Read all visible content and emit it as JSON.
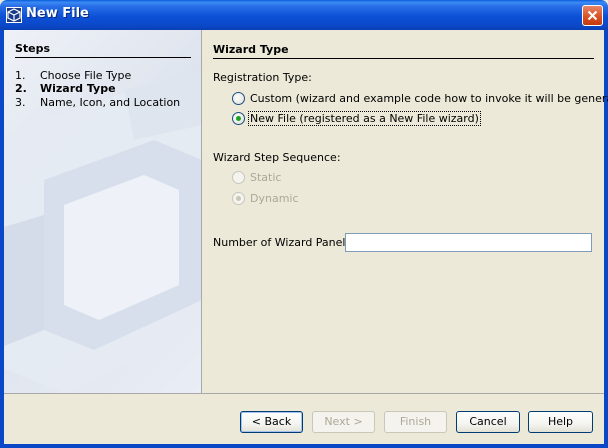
{
  "window": {
    "title": "New File"
  },
  "steps": {
    "title": "Steps",
    "items": [
      {
        "num": "1.",
        "label": "Choose File Type",
        "current": false
      },
      {
        "num": "2.",
        "label": "Wizard Type",
        "current": true
      },
      {
        "num": "3.",
        "label": "Name, Icon, and Location",
        "current": false
      }
    ]
  },
  "content": {
    "section_title": "Wizard Type",
    "registration_label": "Registration Type:",
    "registration_options": [
      {
        "label": "Custom (wizard and example code how to invoke it will be generated)",
        "checked": false
      },
      {
        "label": "New File (registered as a New File wizard)",
        "checked": true
      }
    ],
    "sequence_label": "Wizard Step Sequence:",
    "sequence_options": [
      {
        "label": "Static",
        "checked": false,
        "disabled": true
      },
      {
        "label": "Dynamic",
        "checked": true,
        "disabled": true
      }
    ],
    "panels_label": "Number of Wizard Panels:",
    "panels_value": ""
  },
  "buttons": {
    "back": "< Back",
    "next": "Next >",
    "finish": "Finish",
    "cancel": "Cancel",
    "help": "Help"
  },
  "icons": {
    "title": "netbeans-cube-icon",
    "close": "close-icon"
  },
  "colors": {
    "titlebar": "#0b48c8",
    "dialog_bg": "#ece9d8",
    "close_button": "#d8501f",
    "radio_checked": "#21a121"
  }
}
